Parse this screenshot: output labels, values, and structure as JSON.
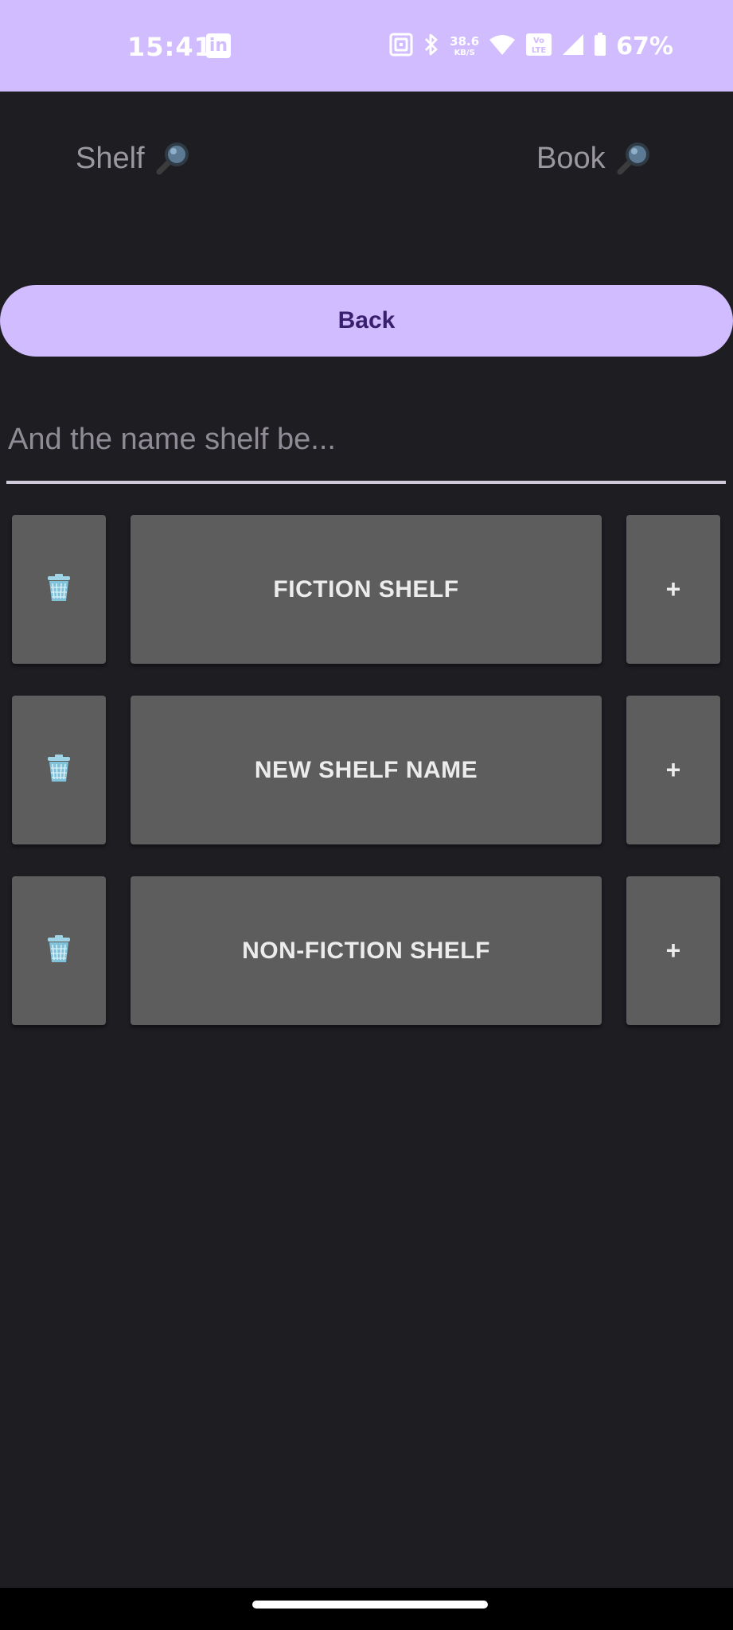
{
  "status_bar": {
    "time": "15:41",
    "net_speed_value": "38.6",
    "net_speed_unit": "KB/S",
    "volte_label": "Vo LTE",
    "battery_percent": "67%",
    "icons": [
      "linkedin-icon",
      "nfc-icon",
      "bluetooth-icon",
      "wifi-icon",
      "volte-icon",
      "signal-icon",
      "battery-icon"
    ],
    "background_color": "#d0bcfe"
  },
  "header": {
    "tabs": [
      {
        "label": "Shelf",
        "icon": "magnifier-icon"
      },
      {
        "label": "Book",
        "icon": "magnifier-icon"
      }
    ]
  },
  "back_button": {
    "label": "Back",
    "color": "#d0bcfe",
    "text_color": "#3a1f6e"
  },
  "shelf_name_input": {
    "value": "",
    "placeholder": "And the name shelf be..."
  },
  "shelves": [
    {
      "delete_icon": "trash-icon",
      "name": "FICTION SHELF",
      "add_label": "+"
    },
    {
      "delete_icon": "trash-icon",
      "name": "NEW SHELF NAME",
      "add_label": "+"
    },
    {
      "delete_icon": "trash-icon",
      "name": "NON-FICTION SHELF",
      "add_label": "+"
    }
  ],
  "colors": {
    "background": "#1e1d22",
    "card": "#5d5d5d"
  }
}
